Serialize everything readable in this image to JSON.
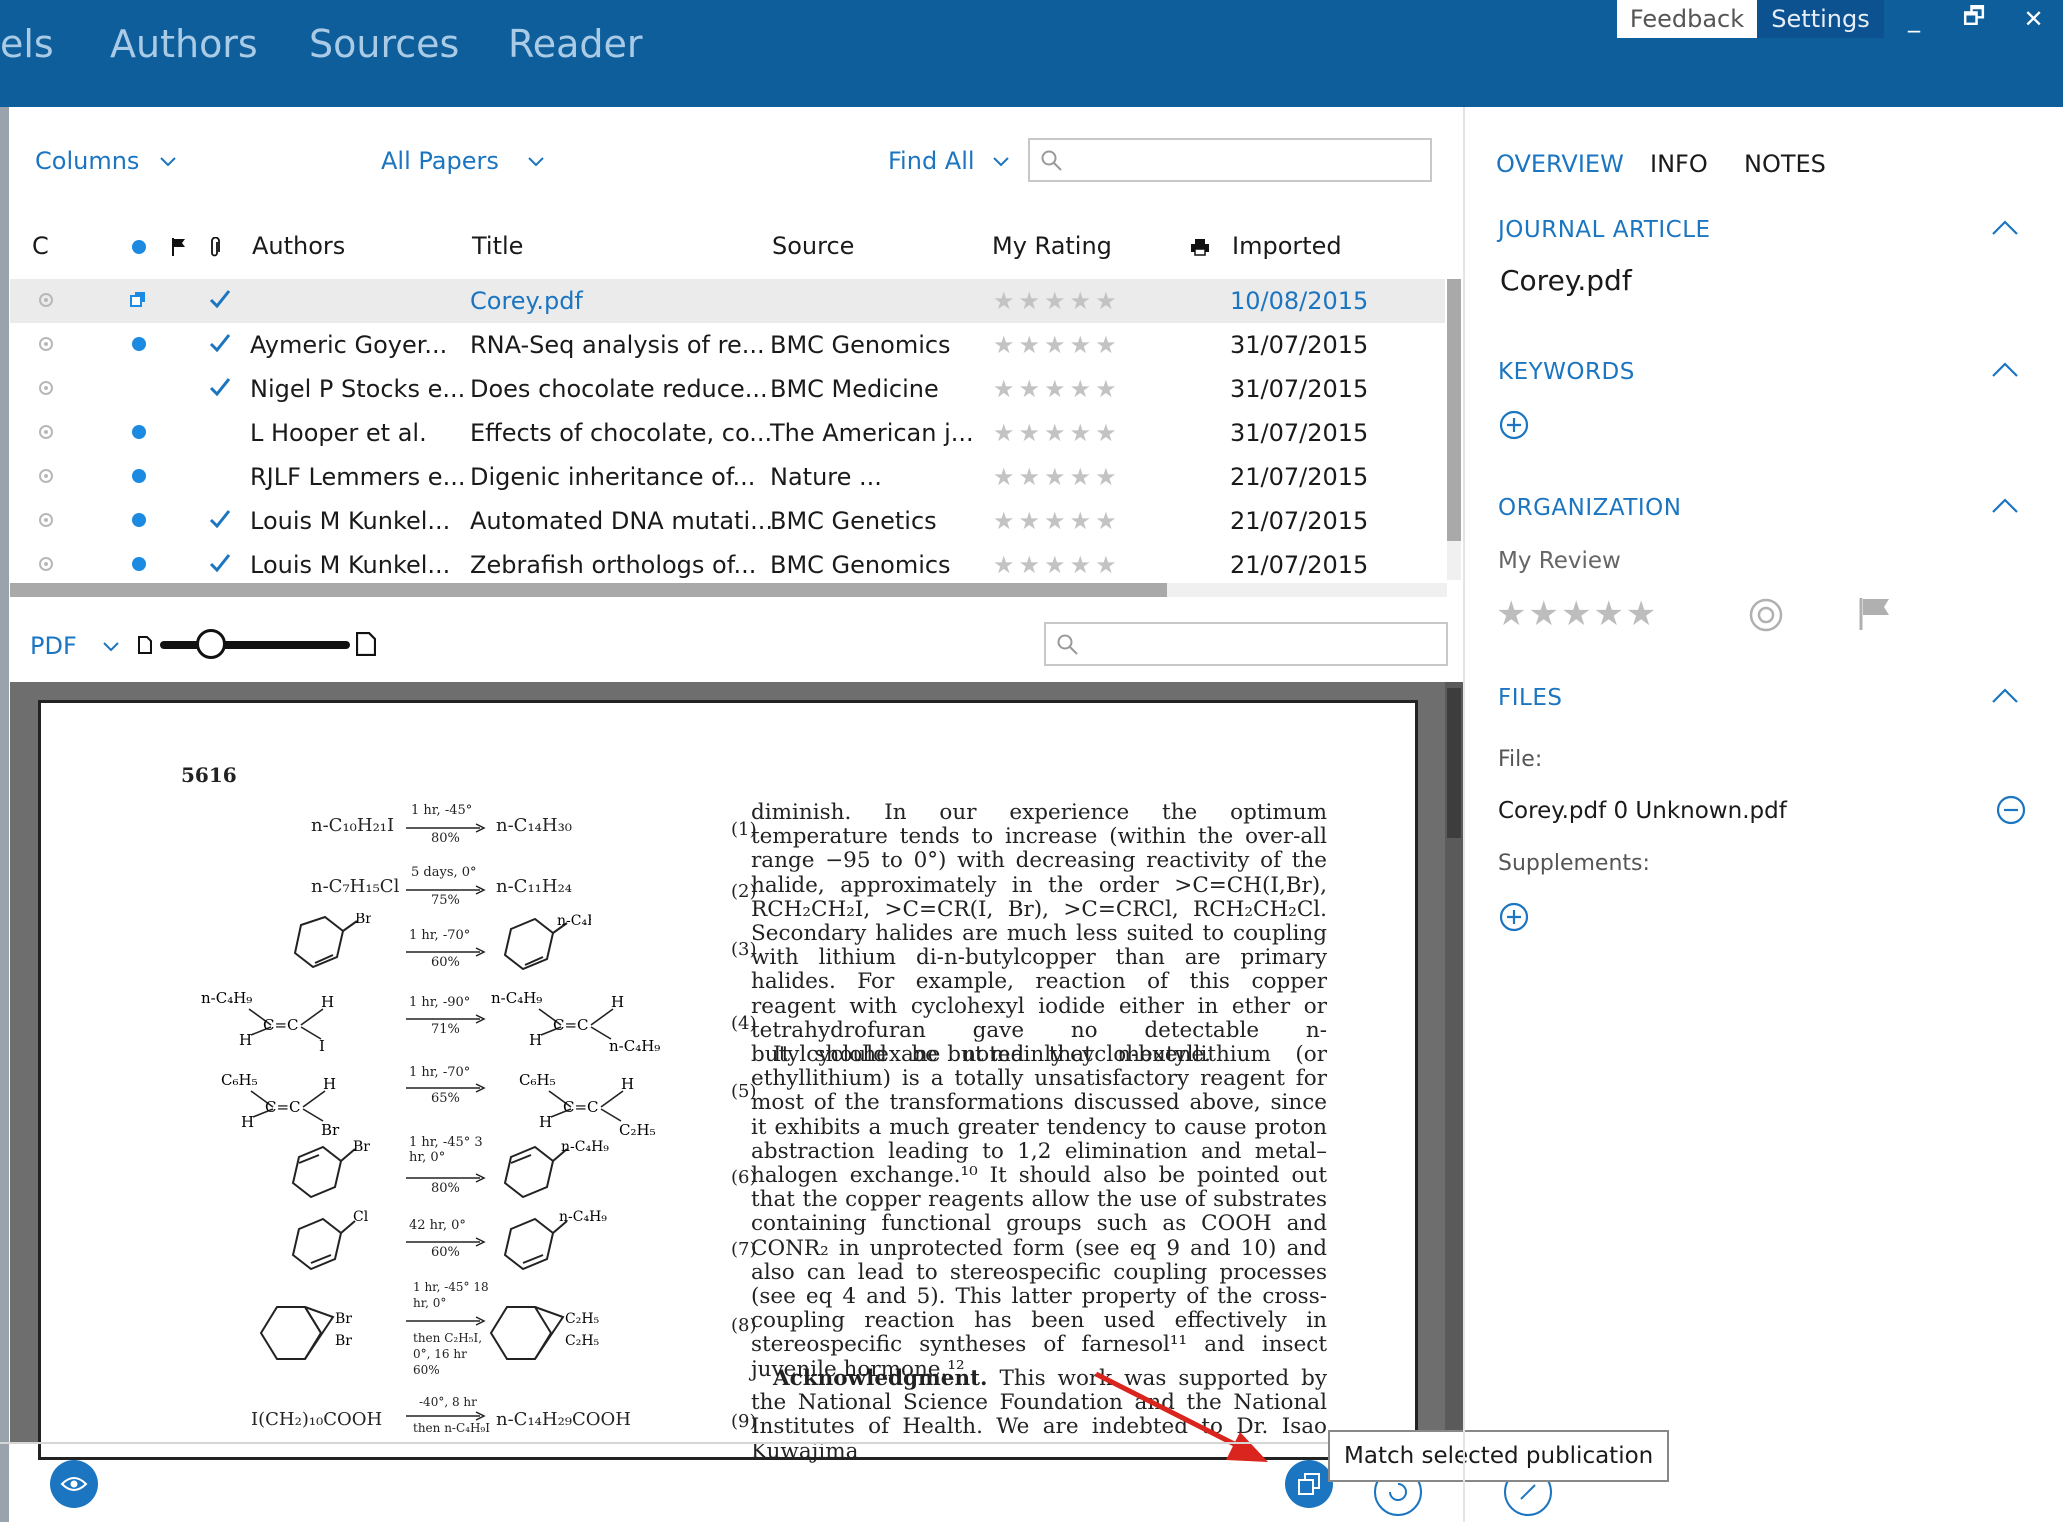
{
  "nav": {
    "tabs": [
      "els",
      "Authors",
      "Sources",
      "Reader"
    ]
  },
  "window": {
    "feedback": "Feedback",
    "settings": "Settings",
    "minimize": "_",
    "restore": "🗗",
    "close": "✕"
  },
  "toolbar": {
    "columns": "Columns",
    "all_papers": "All Papers",
    "find_all": "Find All",
    "search_placeholder": ""
  },
  "table": {
    "headers": {
      "c": "C",
      "authors": "Authors",
      "title": "Title",
      "source": "Source",
      "rating": "My Rating",
      "imported": "Imported"
    },
    "rows": [
      {
        "authors": "",
        "title": "Corey.pdf",
        "source": "",
        "imported": "10/08/2015",
        "unread": false,
        "checked": true,
        "selected": true,
        "stars": "★★★★★"
      },
      {
        "authors": "Aymeric Goyer...",
        "title": "RNA-Seq analysis of re...",
        "source": "BMC Genomics",
        "imported": "31/07/2015",
        "unread": true,
        "checked": true,
        "stars": "★★★★★"
      },
      {
        "authors": "Nigel P Stocks e...",
        "title": "Does chocolate reduce...",
        "source": "BMC Medicine",
        "imported": "31/07/2015",
        "unread": false,
        "checked": true,
        "stars": "★★★★★"
      },
      {
        "authors": "L Hooper et al.",
        "title": "Effects of chocolate, co...",
        "source": "The American j...",
        "imported": "31/07/2015",
        "unread": true,
        "checked": false,
        "stars": "★★★★★"
      },
      {
        "authors": "RJLF Lemmers e...",
        "title": "Digenic inheritance of...",
        "source": "Nature  ...",
        "imported": "21/07/2015",
        "unread": true,
        "checked": false,
        "stars": "★★★★★"
      },
      {
        "authors": "Louis M Kunkel...",
        "title": "Automated DNA mutati...",
        "source": "BMC Genetics",
        "imported": "21/07/2015",
        "unread": true,
        "checked": true,
        "stars": "★★★★★"
      },
      {
        "authors": "Louis M Kunkel...",
        "title": "Zebrafish orthologs of...",
        "source": "BMC Genomics",
        "imported": "21/07/2015",
        "unread": true,
        "checked": true,
        "stars": "★★★★★"
      }
    ]
  },
  "viewer": {
    "mode": "PDF",
    "zoom_fraction": 0.27
  },
  "paper": {
    "page_number": "5616",
    "eq_numbers": [
      "(1)",
      "(2)",
      "(3)",
      "(4)",
      "(5)",
      "(6)",
      "(7)",
      "(8)",
      "(9)"
    ],
    "eq1_left": "n-C₁₀H₂₁I",
    "eq1_cond": "1 hr, -45°",
    "eq1_yield": "80%",
    "eq1_right": "n-C₁₄H₃₀",
    "eq2_left": "n-C₇H₁₅Cl",
    "eq2_cond": "5 days, 0°",
    "eq2_yield": "75%",
    "eq2_right": "n-C₁₁H₂₄",
    "eq3_cond": "1 hr, -70°",
    "eq3_yield": "60%",
    "eq4_cond": "1 hr, -90°",
    "eq4_yield": "71%",
    "eq5_cond": "1 hr, -70°",
    "eq5_yield": "65%",
    "eq6_cond": "1 hr, -45° 3 hr, 0°",
    "eq6_yield": "80%",
    "eq7_cond": "42 hr, 0°",
    "eq7_yield": "60%",
    "eq8_cond": "1 hr, -45° 18 hr, 0°",
    "eq8_yield": "then C₂H₅I, 0°, 16 hr 60%",
    "eq9_left": "I(CH₂)₁₀COOH",
    "eq9_cond": "-40°, 8 hr",
    "eq9_yield": "then n-C₄H₉I",
    "eq9_right": "n-C₁₄H₂₉COOH",
    "text": "diminish. In our experience the optimum temperature tends to increase (within the over-all range −95 to 0°) with decreasing reactivity of the halide, approximately in the order >C=CH(I,Br), RCH₂CH₂I, >C=CR(I, Br), >C=CRCl, RCH₂CH₂Cl. Secondary halides are much less suited to coupling with lithium di-n-butylcopper than are primary halides. For example, reaction of this copper reagent with cyclohexyl iodide either in ether or tetrahydrofuran gave no detectable n-butylcyclohexane but mainly cyclohexene.",
    "text2": "It should be noted that n-butyllithium (or ethyllithium) is a totally unsatisfactory reagent for most of the transformations discussed above, since it exhibits a much greater tendency to cause proton abstraction leading to 1,2 elimination and metal–halogen exchange.¹⁰ It should also be pointed out that the copper reagents allow the use of substrates containing functional groups such as COOH and CONR₂ in unprotected form (see eq 9 and 10) and also can lead to stereospecific coupling processes (see eq 4 and 5). This latter property of the cross-coupling reaction has been used effectively in stereospecific syntheses of farnesol¹¹ and insect juvenile hormone.¹²",
    "ack_label": "Acknowledgment.",
    "ack_text": "This work was supported by the National Science Foundation and the National Institutes of Health. We are indebted to Dr. Isao Kuwajima"
  },
  "right": {
    "tabs": [
      "OVERVIEW",
      "INFO",
      "NOTES"
    ],
    "type_heading": "JOURNAL ARTICLE",
    "doc_title": "Corey.pdf",
    "keywords_heading": "KEYWORDS",
    "org_heading": "ORGANIZATION",
    "my_review": "My Review",
    "review_stars": "★★★★★",
    "files_heading": "FILES",
    "file_label": "File:",
    "file_name": "Corey.pdf 0 Unknown.pdf",
    "supplements_label": "Supplements:"
  },
  "tooltip": "Match selected publication",
  "colors": {
    "header": "#0f5e9c",
    "accent": "#1b75c0",
    "unread_dot": "#1b8ae0",
    "annotation_arrow": "#d9251d"
  }
}
